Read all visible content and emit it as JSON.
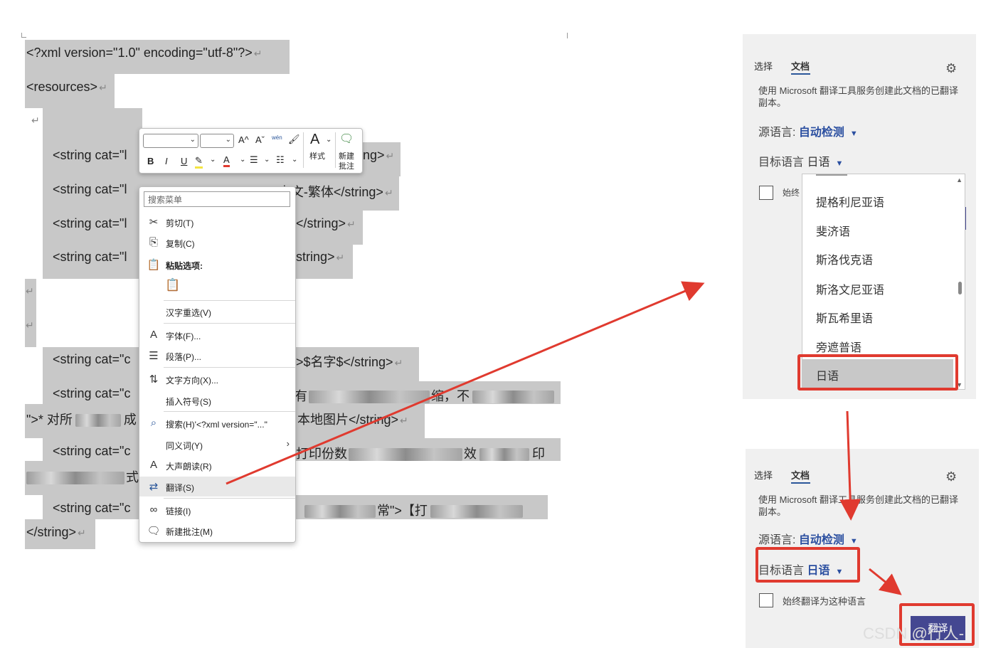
{
  "document": {
    "lines": [
      {
        "id": "l1",
        "text": "<?xml version=\"1.0\" encoding=\"utf-8\"?>"
      },
      {
        "id": "l2",
        "text": "<resources>"
      },
      {
        "id": "l4a",
        "text": "<string cat=\"l"
      },
      {
        "id": "l4b",
        "text": "ng>"
      },
      {
        "id": "l5a",
        "text": "<string cat=\"l"
      },
      {
        "id": "l5b",
        "text": "HK\">中文-繁体</string>"
      },
      {
        "id": "l6a",
        "text": "<string cat=\"l"
      },
      {
        "id": "l6b",
        "text": "</string>"
      },
      {
        "id": "l7a",
        "text": "<string cat=\"l"
      },
      {
        "id": "l7b",
        "text": "string>"
      },
      {
        "id": "l10a",
        "text": "<string cat=\"c"
      },
      {
        "id": "l10b",
        "text": ">$名字$</string>"
      },
      {
        "id": "l11a",
        "text": "<string cat=\"c"
      },
      {
        "id": "l11b",
        "text": "有"
      },
      {
        "id": "l11c",
        "text": "缩，不"
      },
      {
        "id": "l12a",
        "text": "\">* 对所"
      },
      {
        "id": "l12b",
        "text": "成"
      },
      {
        "id": "l12c",
        "text": "本地图片</string>"
      },
      {
        "id": "l13a",
        "text": "<string cat=\"c"
      },
      {
        "id": "l13b",
        "text": "打印份数"
      },
      {
        "id": "l13c",
        "text": "效"
      },
      {
        "id": "l13d",
        "text": "印"
      },
      {
        "id": "l14a",
        "text": "式"
      },
      {
        "id": "l15a",
        "text": "<string cat=\"c"
      },
      {
        "id": "l15b",
        "text": "常\">【打"
      },
      {
        "id": "l16a",
        "text": "</string>"
      }
    ],
    "para_mark": "↵"
  },
  "mini_toolbar": {
    "grow_font": "A^",
    "shrink_font": "Aˇ",
    "phonetic": "wén",
    "bold": "B",
    "italic": "I",
    "underline": "U",
    "font_color": "A",
    "styles_label": "样式",
    "new_comment_line1": "新建",
    "new_comment_line2": "批注"
  },
  "context_menu": {
    "search_placeholder": "搜索菜单",
    "items": {
      "cut": "剪切(T)",
      "copy": "复制(C)",
      "paste_options": "粘贴选项:",
      "reconvert": "汉字重选(V)",
      "font": "字体(F)...",
      "paragraph": "段落(P)...",
      "text_direction": "文字方向(X)...",
      "insert_symbol": "插入符号(S)",
      "search": "搜索(H)'<?xml version=\"...\"",
      "synonyms": "同义词(Y)",
      "read_aloud": "大声朗读(R)",
      "translate": "翻译(S)",
      "link": "链接(I)",
      "new_comment": "新建批注(M)"
    }
  },
  "panel_top": {
    "tab_select": "选择",
    "tab_document": "文档",
    "description": "使用 Microsoft 翻译工具服务创建此文档的已翻译副本。",
    "source_label": "源语言:",
    "source_value": "自动检测",
    "target_label": "目标语言",
    "target_value": "日语",
    "always_partial": "始终",
    "dropdown_items": [
      "提格利尼亚语",
      "斐济语",
      "斯洛伐克语",
      "斯洛文尼亚语",
      "斯瓦希里语",
      "旁遮普语",
      "日语"
    ],
    "dropdown_selected": "日语"
  },
  "panel_bottom": {
    "tab_select": "选择",
    "tab_document": "文档",
    "description": "使用 Microsoft 翻译工具服务创建此文档的已翻译副本。",
    "source_label": "源语言:",
    "source_value": "自动检测",
    "target_label": "目标语言",
    "target_value": "日语",
    "always_translate": "始终翻译为这种语言",
    "translate_button": "翻译"
  },
  "watermark": "CSDN @行人-",
  "colors": {
    "selection": "#c8c8c8",
    "accent": "#2b4fa0",
    "button": "#444791",
    "annotation_red": "#e03a2f"
  }
}
